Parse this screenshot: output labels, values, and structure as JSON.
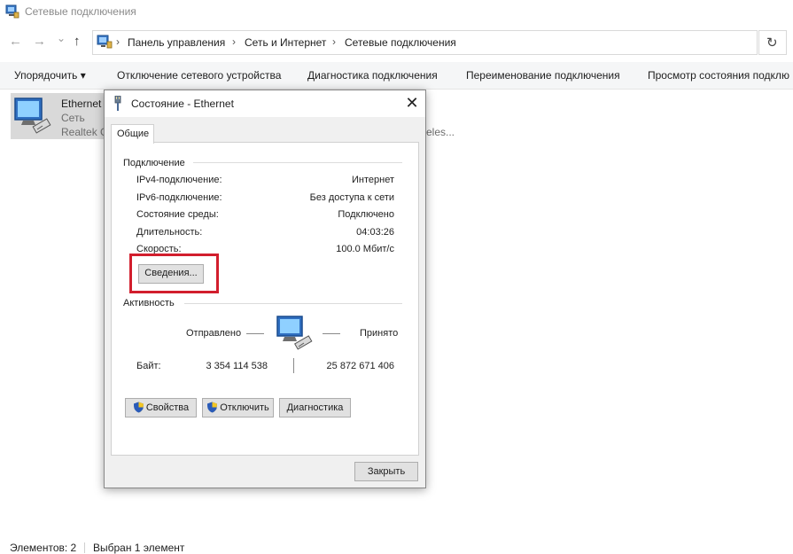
{
  "window": {
    "title": "Сетевые подключения",
    "app_icon": "network-connections-icon"
  },
  "nav": {
    "back_icon": "arrow-left-icon",
    "forward_icon": "arrow-right-icon",
    "recent_icon": "chevron-down-icon",
    "up_icon": "arrow-up-icon",
    "back_glyph": "←",
    "forward_glyph": "→",
    "recent_glyph": "⌄",
    "up_glyph": "↑",
    "crumb_sep": "›",
    "breadcrumbs": [
      "Панель управления",
      "Сеть и Интернет",
      "Сетевые подключения"
    ],
    "refresh_glyph": "↻"
  },
  "toolbar": {
    "organize": "Упорядочить",
    "organize_arrow": "▾",
    "disable": "Отключение сетевого устройства",
    "diagnose": "Диагностика подключения",
    "rename": "Переименование подключения",
    "view_status": "Просмотр состояния подклю"
  },
  "file_item": {
    "name": "Ethernet",
    "type": "Сеть",
    "device": "Realtek G",
    "partial_text": "eles..."
  },
  "statusbar": {
    "count": "Элементов: 2",
    "selected": "Выбран 1 элемент"
  },
  "dialog": {
    "title": "Состояние - Ethernet",
    "close_glyph": "✕",
    "tab": "Общие",
    "connection": {
      "group_title": "Подключение",
      "rows": [
        {
          "label": "IPv4-подключение:",
          "value": "Интернет"
        },
        {
          "label": "IPv6-подключение:",
          "value": "Без доступа к сети"
        },
        {
          "label": "Состояние среды:",
          "value": "Подключено"
        },
        {
          "label": "Длительность:",
          "value": "04:03:26"
        },
        {
          "label": "Скорость:",
          "value": "100.0 Мбит/с"
        }
      ],
      "details_button": "Сведения..."
    },
    "activity": {
      "group_title": "Активность",
      "sent_label": "Отправлено",
      "received_label": "Принято",
      "bytes_label": "Байт:",
      "bytes_sent": "3 354 114 538",
      "bytes_received": "25 872 671 406"
    },
    "buttons": {
      "properties": "Свойства",
      "disable": "Отключить",
      "diagnose": "Диагностика",
      "close": "Закрыть"
    }
  },
  "colors": {
    "highlight": "#d21e2d",
    "selection": "#d9d9d9",
    "toolbar_bg": "#f5f6f7",
    "dialog_bg": "#f0f0f0"
  }
}
